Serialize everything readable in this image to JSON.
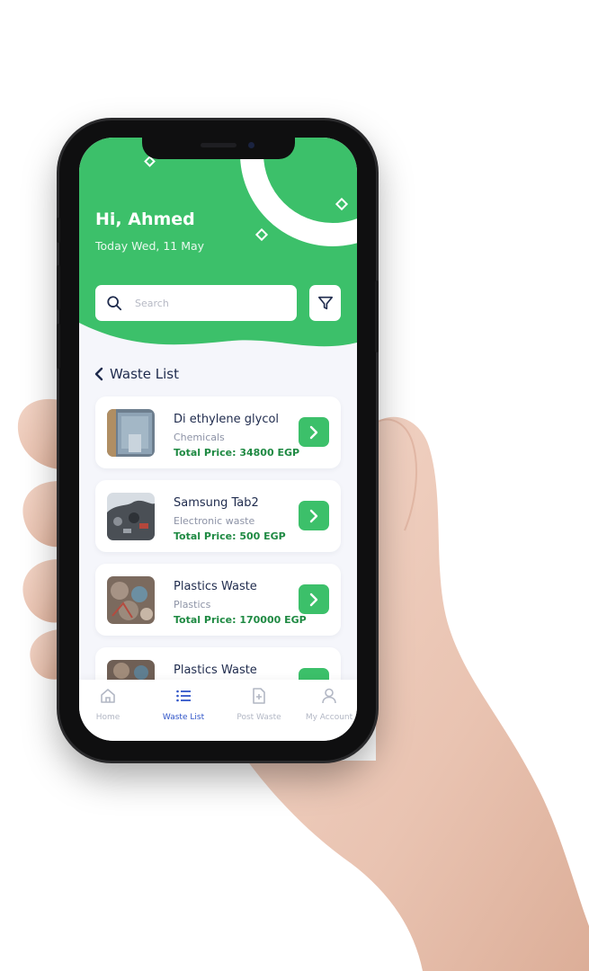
{
  "header": {
    "greeting": "Hi, Ahmed",
    "date": "Today Wed, 11 May"
  },
  "search": {
    "placeholder": "Search"
  },
  "section": {
    "title": "Waste List"
  },
  "items": [
    {
      "name": "Di ethylene glycol",
      "category": "Chemicals",
      "price": "Total Price: 34800 EGP"
    },
    {
      "name": "Samsung Tab2",
      "category": "Electronic waste",
      "price": "Total Price: 500 EGP"
    },
    {
      "name": "Plastics Waste",
      "category": "Plastics",
      "price": "Total Price: 170000 EGP"
    },
    {
      "name": "Plastics Waste"
    }
  ],
  "tabs": [
    {
      "label": "Home",
      "icon": "home-icon"
    },
    {
      "label": "Waste List",
      "icon": "list-icon",
      "active": true
    },
    {
      "label": "Post Waste",
      "icon": "document-plus-icon"
    },
    {
      "label": "My Account",
      "icon": "user-icon"
    }
  ],
  "colors": {
    "brand_green": "#3cc06a",
    "price_green": "#1f8a43",
    "text_dark": "#1f2b4d",
    "active_tab": "#2f54c8"
  }
}
